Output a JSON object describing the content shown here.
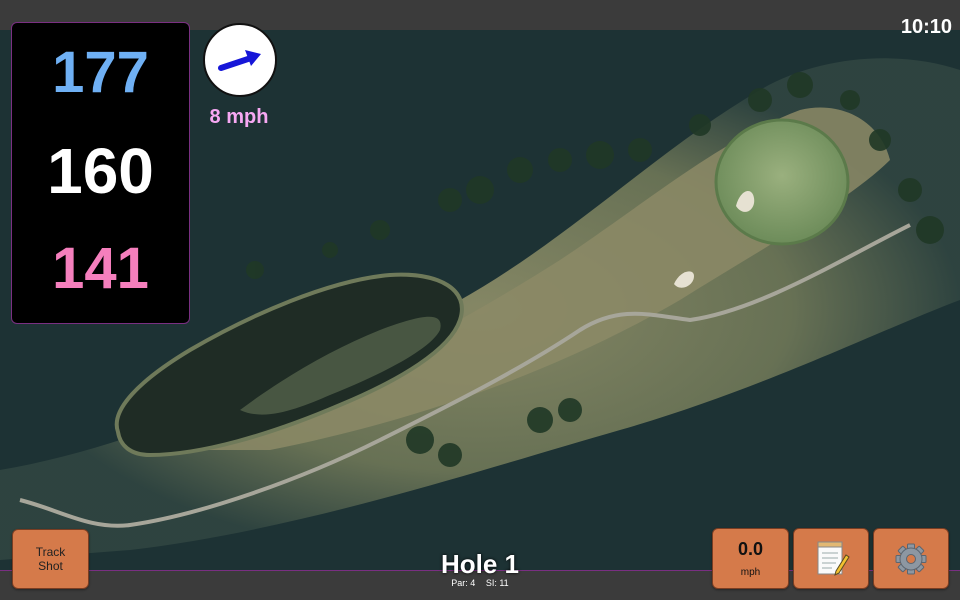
{
  "clock": "10:10",
  "distances": {
    "back": "177",
    "middle": "160",
    "front": "141"
  },
  "wind": {
    "speed_label": "8 mph",
    "direction_icon": "wind-arrow-icon",
    "arrow_color": "#1616d8"
  },
  "track_button": {
    "line1": "Track",
    "line2": "Shot"
  },
  "speed": {
    "value": "0.0",
    "unit": "mph"
  },
  "notes_button": {
    "icon": "notepad-icon"
  },
  "settings_button": {
    "icon": "gear-icon"
  },
  "hole": {
    "title": "Hole 1",
    "par": "Par: 4",
    "si": "SI: 11"
  },
  "colors": {
    "back": "#6fb0f4",
    "middle": "#ffffff",
    "front": "#f57fbd",
    "button": "#d57a4a",
    "border": "#7a2f82"
  }
}
